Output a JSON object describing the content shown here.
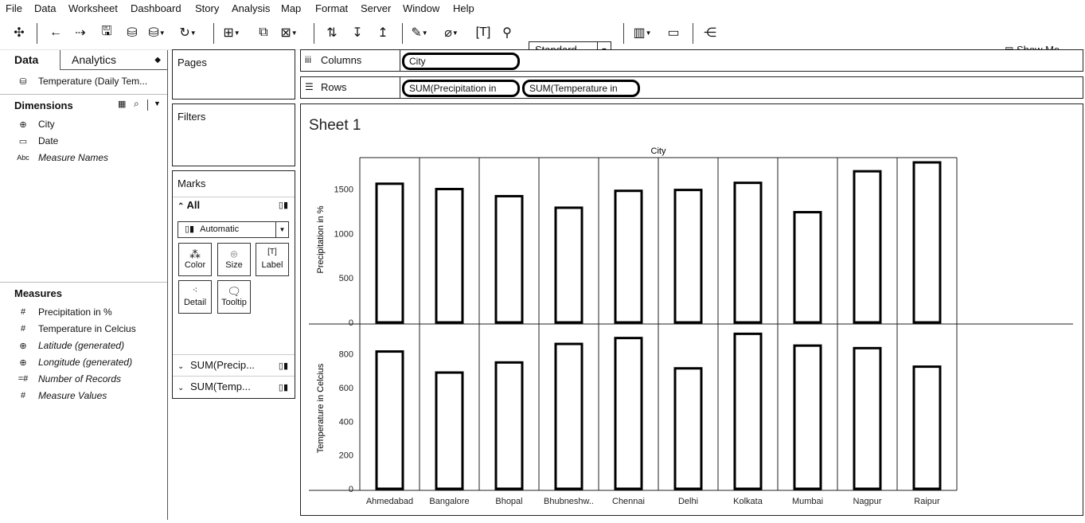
{
  "menu": [
    "File",
    "Data",
    "Worksheet",
    "Dashboard",
    "Story",
    "Analysis",
    "Map",
    "Format",
    "Server",
    "Window",
    "Help"
  ],
  "toolbar": {
    "fit_value": "Standard",
    "show_me": "Show Me"
  },
  "data_pane": {
    "tab_data": "Data",
    "tab_analytics": "Analytics",
    "datasource": "Temperature (Daily Tem...",
    "dimensions_title": "Dimensions",
    "dimensions": [
      {
        "icon": "globe-icon",
        "label": "City",
        "italic": false
      },
      {
        "icon": "calendar-icon",
        "label": "Date",
        "italic": false
      },
      {
        "icon": "abc-icon",
        "label": "Measure Names",
        "italic": true
      }
    ],
    "measures_title": "Measures",
    "measures": [
      {
        "icon": "hash-icon",
        "label": "Precipitation in %",
        "italic": false
      },
      {
        "icon": "hash-icon",
        "label": "Temperature in Celcius",
        "italic": false
      },
      {
        "icon": "geo-globe-icon",
        "label": "Latitude (generated)",
        "italic": true
      },
      {
        "icon": "geo-globe-icon",
        "label": "Longitude (generated)",
        "italic": true
      },
      {
        "icon": "hash-icon",
        "label": "Number of Records",
        "italic": true
      },
      {
        "icon": "hash-icon",
        "label": "Measure Values",
        "italic": true
      }
    ]
  },
  "cards": {
    "pages": "Pages",
    "filters": "Filters",
    "marks": "Marks",
    "marks_all": "All",
    "mark_type": "Automatic",
    "buttons": [
      "Color",
      "Size",
      "Label",
      "Detail",
      "Tooltip"
    ],
    "mark_sections": [
      "SUM(Precip...",
      "SUM(Temp..."
    ]
  },
  "shelves": {
    "columns_label": "Columns",
    "rows_label": "Rows",
    "columns_pills": [
      "City"
    ],
    "rows_pills": [
      "SUM(Precipitation in",
      "SUM(Temperature in"
    ]
  },
  "sheet": {
    "title": "Sheet 1"
  },
  "chart_data": {
    "type": "bar",
    "column_header": "City",
    "categories": [
      "Ahmedabad",
      "Bangalore",
      "Bhopal",
      "Bhubneshw..",
      "Chennai",
      "Delhi",
      "Kolkata",
      "Mumbai",
      "Nagpur",
      "Raipur"
    ],
    "series": [
      {
        "axis_label": "Precipitation in %",
        "values": [
          1560,
          1500,
          1420,
          1290,
          1480,
          1490,
          1570,
          1240,
          1700,
          1800
        ],
        "ylim": [
          0,
          1800
        ],
        "ticks": [
          0,
          500,
          1000,
          1500
        ]
      },
      {
        "axis_label": "Temperature in Celcius",
        "values": [
          815,
          690,
          750,
          860,
          895,
          715,
          920,
          850,
          835,
          725
        ],
        "ylim": [
          0,
          950
        ],
        "ticks": [
          0,
          200,
          400,
          600,
          800
        ]
      }
    ]
  }
}
